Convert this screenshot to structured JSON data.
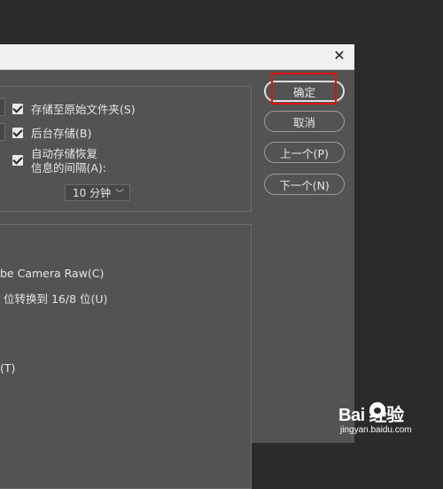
{
  "options": {
    "save_in_original_folder": "存储至原始文件夹(S)",
    "background_save": "后台存储(B)",
    "auto_save_line1": "自动存储恢复",
    "auto_save_line2": "信息的间隔(A):",
    "interval_value": "10 分钟"
  },
  "raw_section": {
    "camera_raw_fragment": "be Camera Raw(C)",
    "convert_fragment": "位转换到 16/8 位(U)",
    "t_fragment": "(T)"
  },
  "buttons": {
    "ok": "确定",
    "cancel": "取消",
    "previous": "上一个(P)",
    "next": "下一个(N)"
  },
  "watermark": {
    "main": "Bai  经验",
    "sub": "jingyan.baidu.com"
  },
  "colors": {
    "dialog_bg": "#535353",
    "highlight": "#e01010"
  }
}
